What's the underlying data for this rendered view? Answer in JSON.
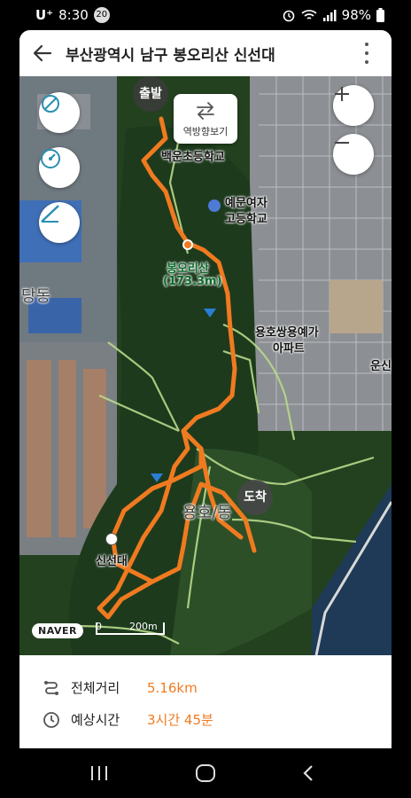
{
  "status": {
    "carrier": "U⁺",
    "time": "8:30",
    "notification_count": "20",
    "battery": "98%"
  },
  "appbar": {
    "title": "부산광역시 남구 봉오리산 신선대"
  },
  "map": {
    "reverse_label": "역방향보기",
    "start_label": "출발",
    "end_label": "도착",
    "labels": {
      "school1": "백운초등학교",
      "school2_line1": "예문여자",
      "school2_line2": "고등학교",
      "peak_name": "봉오리산",
      "peak_height": "(173.3m)",
      "apt_line1": "용호쌍용예가",
      "apt_line2": "아파트",
      "district": "당동",
      "edge": "운신",
      "yongho": "용호/동",
      "sinseondae": "신선대"
    },
    "naver_logo": "NAVER",
    "scale_zero": "0",
    "scale_distance": "200m"
  },
  "info": {
    "distance_label": "전체거리",
    "distance_value": "5.16km",
    "time_label": "예상시간",
    "time_value": "3시간 45분"
  },
  "colors": {
    "route": "#f07a20",
    "accent": "#f07a20",
    "control_icon": "#2a8fb0"
  },
  "icons": [
    "back-arrow-icon",
    "more-vert-icon",
    "no-route-icon",
    "speedometer-icon",
    "slope-icon",
    "plus-icon",
    "minus-icon",
    "swap-icon",
    "distance-icon",
    "clock-icon",
    "school-icon",
    "recent-apps-icon",
    "home-icon",
    "back-nav-icon",
    "wifi-icon",
    "signal-icon",
    "battery-icon",
    "alarm-icon"
  ]
}
